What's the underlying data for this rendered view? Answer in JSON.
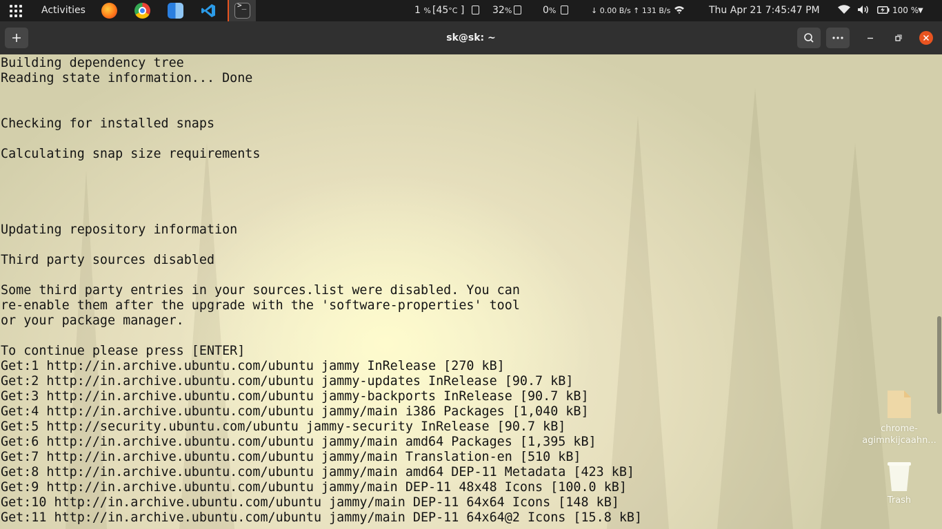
{
  "topbar": {
    "activities": "Activities",
    "dock": [
      {
        "name": "firefox",
        "color": "#e66000"
      },
      {
        "name": "chrome",
        "color": "#4285f4"
      },
      {
        "name": "finder",
        "color": "#3b8fe0"
      },
      {
        "name": "vscode",
        "color": "#2b89d7"
      },
      {
        "name": "terminal",
        "color": "#2c2c2c"
      }
    ],
    "cpu_value": "1",
    "cpu_unit": "%",
    "temp_value": "[45",
    "temp_unit": "°C",
    "temp_close": "]",
    "mem_value": "32",
    "mem_unit": "%",
    "swap_value": "0",
    "swap_unit": "%",
    "net": "↓ 0.00 B/s ↑ 131 B/s",
    "datetime": "Thu Apr 21  7:45:47 PM",
    "battery": "100 %"
  },
  "header": {
    "title": "sk@sk: ~"
  },
  "terminal": {
    "lines": [
      "Building dependency tree",
      "Reading state information... Done",
      "",
      "",
      "Checking for installed snaps",
      "",
      "Calculating snap size requirements",
      "",
      "",
      "",
      "",
      "Updating repository information",
      "",
      "Third party sources disabled",
      "",
      "Some third party entries in your sources.list were disabled. You can",
      "re-enable them after the upgrade with the 'software-properties' tool",
      "or your package manager.",
      "",
      "To continue please press [ENTER]",
      "Get:1 http://in.archive.ubuntu.com/ubuntu jammy InRelease [270 kB]",
      "Get:2 http://in.archive.ubuntu.com/ubuntu jammy-updates InRelease [90.7 kB]",
      "Get:3 http://in.archive.ubuntu.com/ubuntu jammy-backports InRelease [90.7 kB]",
      "Get:4 http://in.archive.ubuntu.com/ubuntu jammy/main i386 Packages [1,040 kB]",
      "Get:5 http://security.ubuntu.com/ubuntu jammy-security InRelease [90.7 kB]",
      "Get:6 http://in.archive.ubuntu.com/ubuntu jammy/main amd64 Packages [1,395 kB]",
      "Get:7 http://in.archive.ubuntu.com/ubuntu jammy/main Translation-en [510 kB]",
      "Get:8 http://in.archive.ubuntu.com/ubuntu jammy/main amd64 DEP-11 Metadata [423 kB]",
      "Get:9 http://in.archive.ubuntu.com/ubuntu jammy/main DEP-11 48x48 Icons [100.0 kB]",
      "Get:10 http://in.archive.ubuntu.com/ubuntu jammy/main DEP-11 64x64 Icons [148 kB]",
      "Get:11 http://in.archive.ubuntu.com/ubuntu jammy/main DEP-11 64x64@2 Icons [15.8 kB]"
    ]
  },
  "desktop": {
    "file_label_1": "chrome-",
    "file_label_2": "agimnkijcaahn...",
    "trash_label": "Trash"
  }
}
